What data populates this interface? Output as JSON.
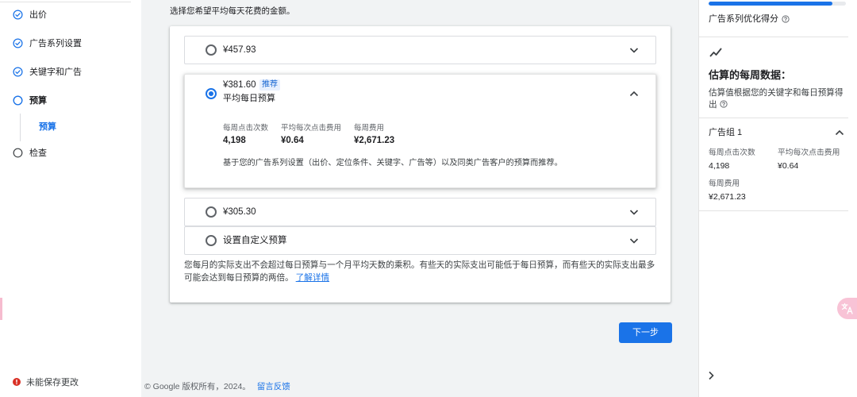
{
  "colors": {
    "accent": "#1a73e8",
    "text": "#202124",
    "secondary_text": "#5f6368",
    "page_background": "#f1f3f4",
    "error": "#d93025",
    "badge_background": "#e8f0fe"
  },
  "sidebar": {
    "steps": [
      {
        "label": "出价",
        "icon": "check-circle-icon"
      },
      {
        "label": "广告系列设置",
        "icon": "check-circle-icon"
      },
      {
        "label": "关键字和广告",
        "icon": "check-circle-icon"
      },
      {
        "label": "预算",
        "icon": "current-step-circle-icon",
        "substeps": [
          {
            "label": "预算"
          }
        ]
      },
      {
        "label": "检查",
        "icon": "pending-step-circle-icon"
      }
    ],
    "save_status": {
      "label": "未能保存更改",
      "icon": "error-icon"
    }
  },
  "main": {
    "intro": "选择您希望平均每天花费的金额。",
    "budget_options": [
      {
        "amount": "¥457.93",
        "selected": false
      },
      {
        "amount": "¥381.60",
        "badge": "推荐",
        "subtitle": "平均每日预算",
        "selected": true,
        "stats": [
          {
            "label": "每周点击次数",
            "value": "4,198"
          },
          {
            "label": "平均每次点击费用",
            "value": "¥0.64"
          },
          {
            "label": "每周费用",
            "value": "¥2,671.23"
          }
        ],
        "description": "基于您的广告系列设置（出价、定位条件、关键字、广告等）以及同类广告客户的预算而推荐。"
      },
      {
        "amount": "¥305.30",
        "selected": false
      },
      {
        "amount": "设置自定义预算",
        "selected": false
      }
    ],
    "note": "您每月的实际支出不会超过每日预算与一个月平均天数的乘积。有些天的实际支出可能低于每日预算，而有些天的实际支出最多可能会达到每日预算的两倍。",
    "learn_more_link": "了解详情",
    "next_button": "下一步"
  },
  "footer": {
    "copyright": "© Google 版权所有，2024。",
    "feedback_link": "留言反馈"
  },
  "right_panel": {
    "optimization_score": {
      "label": "广告系列优化得分",
      "fill": 0.9
    },
    "estimates": {
      "title": "估算的每周数据：",
      "note": "估算值根据您的关键字和每日预算得出",
      "ad_group": {
        "name": "广告组 1",
        "stats": [
          {
            "label": "每周点击次数",
            "value": "4,198"
          },
          {
            "label": "平均每次点击费用",
            "value": "¥0.64"
          },
          {
            "label": "每周费用",
            "value": "¥2,671.23"
          }
        ]
      }
    }
  }
}
